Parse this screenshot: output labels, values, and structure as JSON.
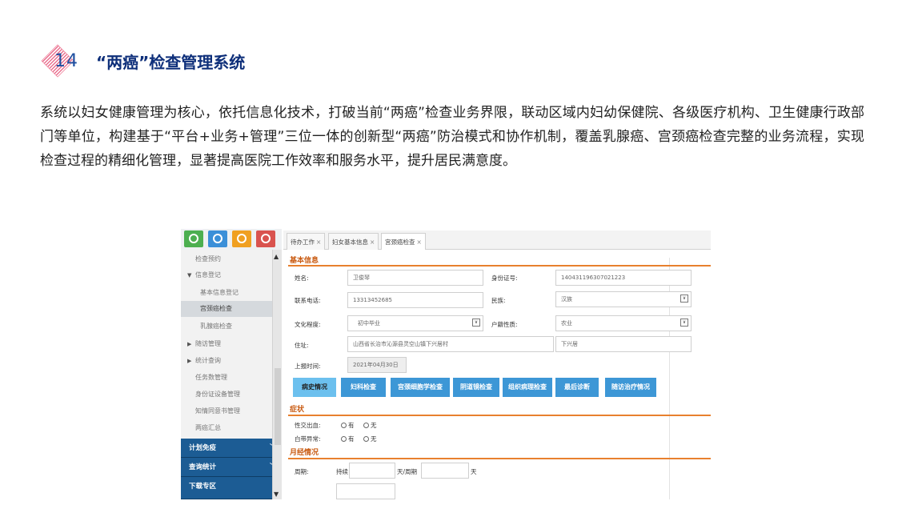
{
  "section": {
    "number": "14",
    "title": "“两癌”检查管理系统"
  },
  "intro": "系统以妇女健康管理为核心，依托信息化技术，打破当前“两癌”检查业务界限，联动区域内妇幼保健院、各级医疗机构、卫生健康行政部门等单位，构建基于“平台+业务+管理”三位一体的创新型“两癌”防治模式和协作机制，覆盖乳腺癌、宫颈癌检查完整的业务流程，实现检查过程的精细化管理，显著提高医院工作效率和服务水平，提升居民满意度。",
  "colors": {
    "brand_blue": "#1c5c94",
    "accent_orange": "#e8802e",
    "button_blue": "#3d97d6",
    "title_navy": "#0e2f7a"
  },
  "app": {
    "icons": [
      {
        "name": "home-icon",
        "color": "#4caf50"
      },
      {
        "name": "clock-icon",
        "color": "#3a8fd8"
      },
      {
        "name": "list-icon",
        "color": "#f0a021"
      },
      {
        "name": "settings-icon",
        "color": "#d9534f"
      }
    ],
    "sidebar": {
      "items": [
        {
          "label": "检查预约"
        },
        {
          "label": "信息登记"
        },
        {
          "label": "基本信息登记"
        },
        {
          "label": "宫颈癌检查"
        },
        {
          "label": "乳腺癌检查"
        },
        {
          "label": "随访管理"
        },
        {
          "label": "统计查询"
        },
        {
          "label": "任务数管理"
        },
        {
          "label": "身份证设备管理"
        },
        {
          "label": "知情同意书管理"
        },
        {
          "label": "两癌汇总"
        }
      ],
      "groups": [
        {
          "label": "计划免疫"
        },
        {
          "label": "查询统计"
        },
        {
          "label": "下载专区"
        }
      ]
    },
    "tabs": [
      {
        "label": "待办工作"
      },
      {
        "label": "妇女基本信息"
      },
      {
        "label": "宫颈癌检查"
      }
    ],
    "form": {
      "basic_title": "基本信息",
      "name_label": "姓名:",
      "name_value": "卫俊琴",
      "id_label": "身份证号:",
      "id_value": "140431196307021223",
      "phone_label": "联系电话:",
      "phone_value": "13313452685",
      "ethnic_label": "民族:",
      "ethnic_value": "汉族",
      "edu_label": "文化程度:",
      "edu_value": "初中毕业",
      "household_label": "户籍性质:",
      "household_value": "农业",
      "address_label": "住址:",
      "address_value": "山西省长治市沁源县灵空山镇下兴居村",
      "address_extra": "下兴居",
      "report_label": "上报时间:",
      "report_value": "2021年04月30日"
    },
    "buttons": [
      {
        "label": "病史情况"
      },
      {
        "label": "妇科检查"
      },
      {
        "label": "宫颈细胞学检查"
      },
      {
        "label": "阴道镜检查"
      },
      {
        "label": "组织病理检查"
      },
      {
        "label": "最后诊断"
      },
      {
        "label": "随访治疗情况"
      }
    ],
    "symptoms": {
      "title": "症状",
      "bleeding_label": "性交出血:",
      "discharge_label": "白带异常:",
      "yes": "有",
      "no": "无"
    },
    "menstrual": {
      "title": "月经情况",
      "cycle_label": "周期:",
      "lasting_label": "持续",
      "days_per_cycle": "天/周期",
      "days": "天"
    }
  }
}
